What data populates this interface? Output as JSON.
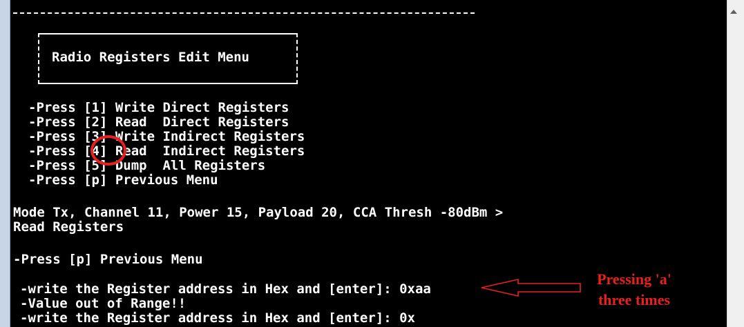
{
  "menu": {
    "title": "Radio Registers Edit Menu",
    "items": [
      "-Press [1] Write Direct Registers",
      "-Press [2] Read  Direct Registers",
      "-Press [3] Write Indirect Registers",
      "-Press [4] Read  Indirect Registers",
      "-Press [5] Dump  All Registers",
      "-Press [p] Previous Menu"
    ]
  },
  "status": {
    "line": "Mode Tx, Channel 11, Power 15, Payload 20, CCA Thresh -80dBm >",
    "action": "Read Registers"
  },
  "submenu": {
    "previous": "-Press [p] Previous Menu"
  },
  "session": [
    "-write the Register address in Hex and [enter]: 0xaa",
    "-Value out of Range!!",
    "-write the Register address in Hex and [enter]: 0x"
  ],
  "annotation": {
    "text_line1": "Pressing 'a'",
    "text_line2": "three times",
    "color": "#e82020"
  },
  "colors": {
    "console_bg": "#000000",
    "console_fg": "#ffffff"
  }
}
